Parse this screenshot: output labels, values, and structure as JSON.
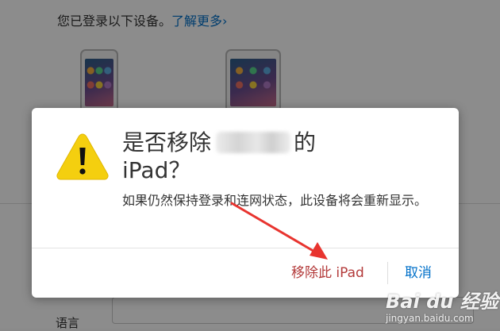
{
  "background": {
    "devices_intro": "您已登录以下设备。",
    "learn_more": "了解更多",
    "learn_more_chevron": "›",
    "language_label": "语言"
  },
  "dialog": {
    "title_prefix": "是否移除",
    "title_suffix": "的",
    "title_line2": "iPad？",
    "body": "如果仍然保持登录和连网状态，此设备将会重新显示。",
    "remove_button": "移除此 iPad",
    "cancel_button": "取消",
    "icon": "warning-icon"
  },
  "watermark": {
    "main": "Bai du 经验",
    "sub": "jingyan.baidu.com"
  },
  "colors": {
    "remove": "#b33a3a",
    "cancel": "#0070c9",
    "warning_fill": "#f4cf0f",
    "annotation_arrow": "#e8342f"
  }
}
